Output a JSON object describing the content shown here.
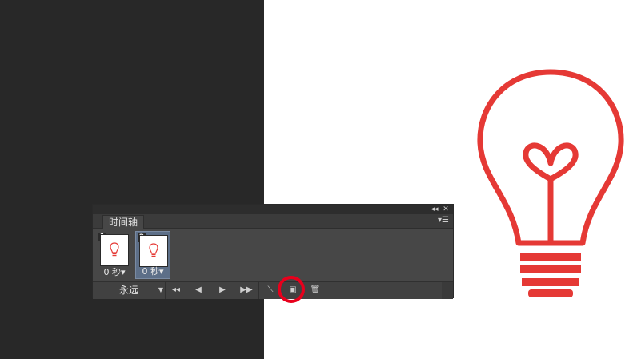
{
  "panel": {
    "collapse_icon": "◂◂",
    "close_icon": "✕",
    "tab_label": "时间轴",
    "menu_icon": "▾☰"
  },
  "frames": [
    {
      "number": "1",
      "delay": "0 秒▾",
      "selected": false
    },
    {
      "number": "2",
      "delay": "0 秒▾",
      "selected": true
    }
  ],
  "toolbar": {
    "loop_label": "永远",
    "loop_arrow": "▼",
    "first_frame": "◂◂",
    "prev_frame": "◀",
    "play": "▶",
    "next_frame": "▶▶",
    "tween": "⟍",
    "duplicate": "▣",
    "delete": "🗑"
  },
  "colors": {
    "accent": "#e8001c",
    "bulb": "#e53935",
    "panel": "#474747",
    "selected_frame": "#5d6f88"
  },
  "icons": [
    "collapse-icon",
    "close-icon",
    "panel-menu-icon",
    "first-frame-icon",
    "prev-frame-icon",
    "play-icon",
    "next-frame-icon",
    "tween-icon",
    "duplicate-frame-icon",
    "trash-icon",
    "lightbulb-icon"
  ]
}
